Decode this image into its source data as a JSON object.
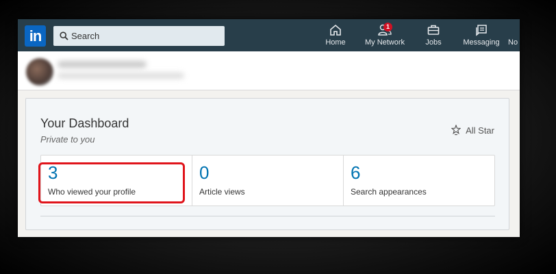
{
  "topnav": {
    "logo_text": "in",
    "search_placeholder": "Search",
    "items": [
      {
        "label": "Home",
        "icon": "home-icon"
      },
      {
        "label": "My Network",
        "icon": "network-icon",
        "badge": "1"
      },
      {
        "label": "Jobs",
        "icon": "briefcase-icon"
      },
      {
        "label": "Messaging",
        "icon": "messaging-icon"
      },
      {
        "label": "No",
        "icon": "notifications-icon"
      }
    ]
  },
  "dashboard": {
    "title": "Your Dashboard",
    "subtitle": "Private to you",
    "all_star": "All Star",
    "stats": [
      {
        "value": "3",
        "label": "Who viewed your profile"
      },
      {
        "value": "0",
        "label": "Article views"
      },
      {
        "value": "6",
        "label": "Search appearances"
      }
    ]
  },
  "colors": {
    "nav_bg": "#283e4a",
    "accent": "#0073b1",
    "highlight": "#e0141b",
    "badge": "#d11124"
  }
}
